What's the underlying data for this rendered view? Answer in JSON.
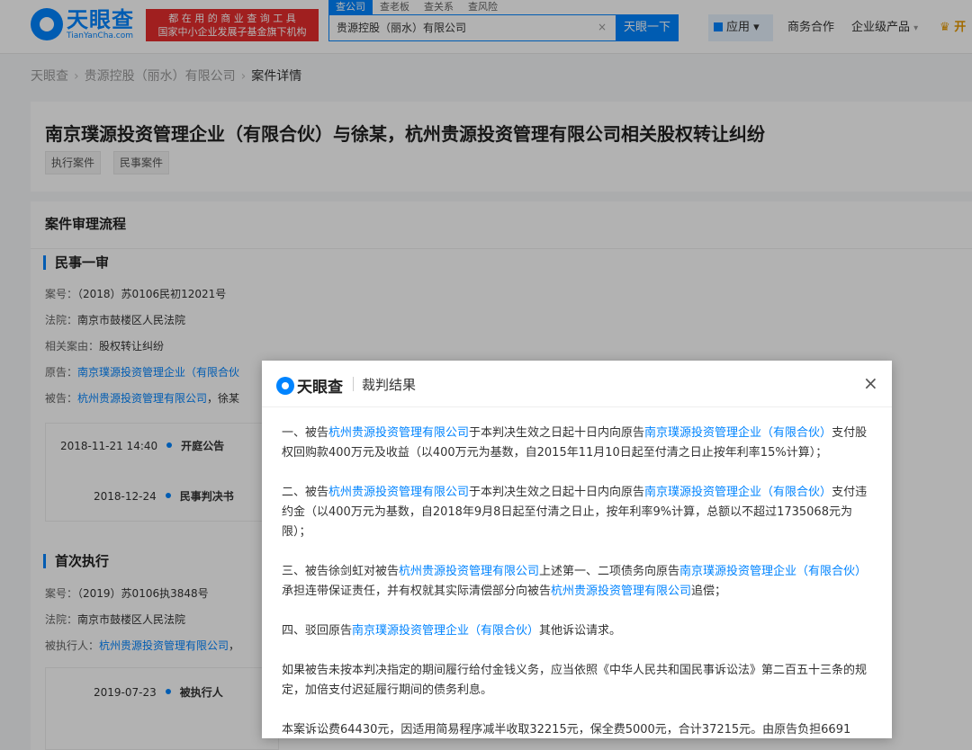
{
  "header": {
    "logo_cn": "天眼查",
    "logo_en": "TianYanCha.com",
    "slogan_line1": "都 在 用 的 商 业 查 询 工 具",
    "slogan_line2": "国家中小企业发展子基金旗下机构",
    "search_tabs": [
      "查公司",
      "查老板",
      "查关系",
      "查风险"
    ],
    "search_value": "贵源控股（丽水）有限公司",
    "search_clear": "×",
    "search_button": "天眼一下",
    "app_button": "应用",
    "nav_business": "商务合作",
    "nav_enterprise": "企业级产品",
    "nav_open": "开"
  },
  "breadcrumb": {
    "home": "天眼查",
    "company": "贵源控股（丽水）有限公司",
    "current": "案件详情",
    "sep": "›"
  },
  "case": {
    "title": "南京璞源投资管理企业（有限合伙）与徐某，杭州贵源投资管理有限公司相关股权转让纠纷",
    "tags": [
      "执行案件",
      "民事案件"
    ]
  },
  "process": {
    "section_title": "案件审理流程",
    "stage1": {
      "title": "民事一审",
      "case_no_label": "案号：",
      "case_no": "（2018）苏0106民初12021号",
      "court_label": "法院：",
      "court": "南京市鼓楼区人民法院",
      "cause_label": "相关案由：",
      "cause": "股权转让纠纷",
      "plaintiff_label": "原告：",
      "plaintiff": "南京璞源投资管理企业（有限合伙",
      "defendant_label": "被告：",
      "defendant": "杭州贵源投资管理有限公司",
      "defendant_extra": "，徐某",
      "timeline": [
        {
          "time": "2018-11-21 14:40",
          "label": "开庭公告"
        },
        {
          "time": "2018-12-24",
          "label": "民事判决书"
        }
      ]
    },
    "stage2": {
      "title": "首次执行",
      "case_no_label": "案号：",
      "case_no": "（2019）苏0106执3848号",
      "court_label": "法院：",
      "court": "南京市鼓楼区人民法院",
      "executed_label": "被执行人：",
      "executed": "杭州贵源投资管理有限公司",
      "executed_extra": "，",
      "timeline": [
        {
          "time": "2019-07-23",
          "label": "被执行人"
        }
      ]
    }
  },
  "modal": {
    "logo_text": "天眼查",
    "title": "裁判结果",
    "close": "×",
    "p1": {
      "a": "一、被告",
      "l1": "杭州贵源投资管理有限公司",
      "b": "于本判决生效之日起十日内向原告",
      "l2": "南京璞源投资管理企业（有限合伙）",
      "c": "支付股权回购款400万元及收益（以400万元为基数，自2015年11月10日起至付清之日止按年利率15%计算）；"
    },
    "p2": {
      "a": "二、被告",
      "l1": "杭州贵源投资管理有限公司",
      "b": "于本判决生效之日起十日内向原告",
      "l2": "南京璞源投资管理企业（有限合伙）",
      "c": "支付违约金（以400万元为基数，自2018年9月8日起至付清之日止，按年利率9%计算，总额以不超过1735068元为限）；"
    },
    "p3": {
      "a": "三、被告徐剑虹对被告",
      "l1": "杭州贵源投资管理有限公司",
      "b": "上述第一、二项债务向原告",
      "l2": "南京璞源投资管理企业（有限合伙）",
      "c": "承担连带保证责任，并有权就其实际清偿部分向被告",
      "l3": "杭州贵源投资管理有限公司",
      "d": "追偿；"
    },
    "p4": {
      "a": "四、驳回原告",
      "l1": "南京璞源投资管理企业（有限合伙）",
      "b": "其他诉讼请求。"
    },
    "p5": "如果被告未按本判决指定的期间履行给付金钱义务，应当依照《中华人民共和国民事诉讼法》第二百五十三条的规定，加倍支付迟延履行期间的债务利息。",
    "p6": "本案诉讼费64430元，因适用简易程序减半收取32215元，保全费5000元，合计37215元。由原告负担6691"
  }
}
